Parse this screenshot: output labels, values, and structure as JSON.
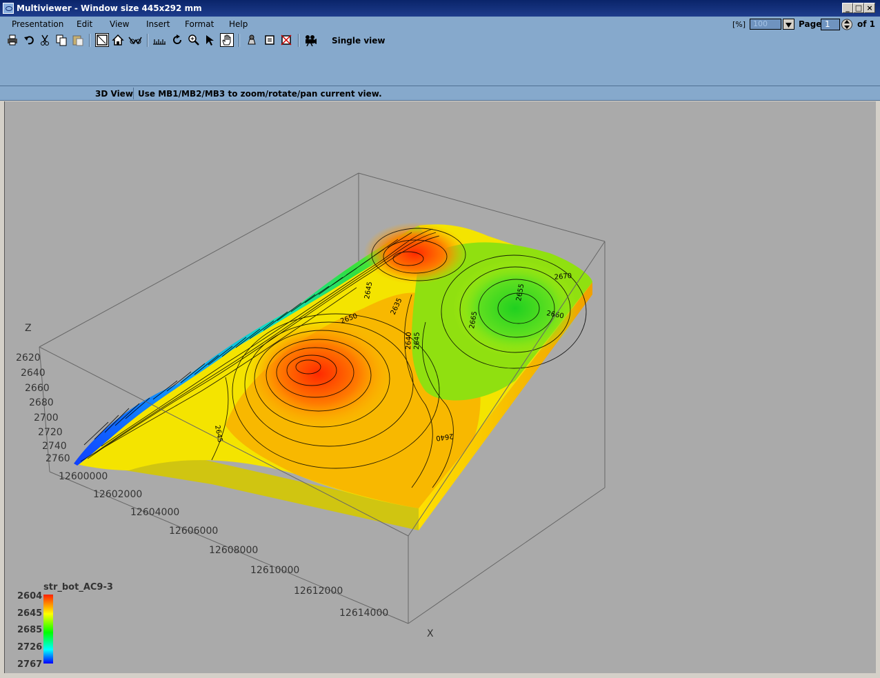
{
  "window": {
    "title": "Multiviewer - Window size 445x292 mm"
  },
  "menu": [
    "Presentation",
    "Edit",
    "View",
    "Insert",
    "Format",
    "Help"
  ],
  "toolbar": {
    "view_mode_label": "Single view"
  },
  "zoom": {
    "label": "[%]",
    "value": "100"
  },
  "pager": {
    "page_label": "Page",
    "current": "1",
    "of_label": "of 1"
  },
  "status": {
    "view_name": "3D View",
    "hint": "Use MB1/MB2/MB3 to zoom/rotate/pan current view."
  },
  "plot": {
    "z_axis_label": "Z",
    "x_axis_label": "X",
    "z_ticks": [
      "2620",
      "2640",
      "2660",
      "2680",
      "2700",
      "2720",
      "2740",
      "2760"
    ],
    "x_ticks": [
      "12600000",
      "12602000",
      "12604000",
      "12606000",
      "12608000",
      "12610000",
      "12612000",
      "12614000"
    ],
    "contour_labels": [
      "2645",
      "2640",
      "2645",
      "2640",
      "2650",
      "2635",
      "2645",
      "2665",
      "2670",
      "2655",
      "2660"
    ]
  },
  "legend": {
    "title": "str_bot_AC9-3",
    "values": [
      "2604",
      "2645",
      "2685",
      "2726",
      "2767"
    ],
    "colors": [
      "#ff2000",
      "#ffff00",
      "#00ff00",
      "#00ffff",
      "#0000ff"
    ]
  }
}
